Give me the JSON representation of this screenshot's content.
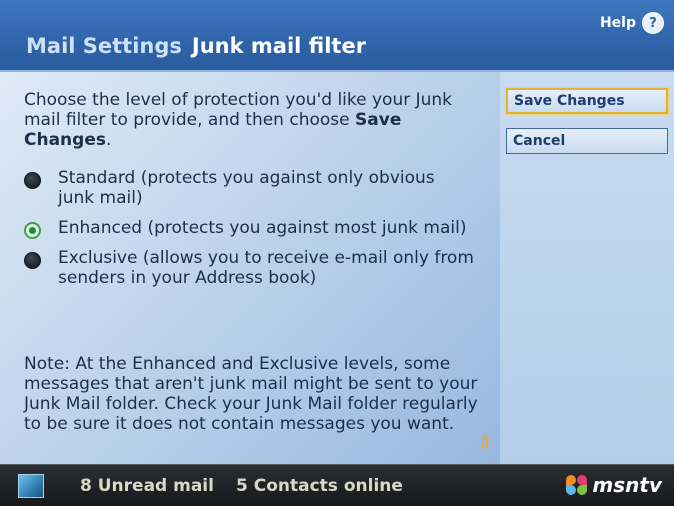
{
  "header": {
    "section": "Mail Settings",
    "title": "Junk mail filter",
    "help_label": "Help",
    "help_icon": "question-circle-icon"
  },
  "intro": {
    "text_before": "Choose the level of protection you'd like your Junk mail filter to provide, and then choose ",
    "bold": "Save Changes",
    "text_after": "."
  },
  "options": [
    {
      "label": "Standard (protects you against only obvious junk mail)",
      "selected": false
    },
    {
      "label": "Enhanced (protects you against most junk mail)",
      "selected": true
    },
    {
      "label": "Exclusive (allows you to receive e-mail only from senders in your Address book)",
      "selected": false
    }
  ],
  "note": "Note: At the Enhanced and Exclusive levels, some messages that aren't junk mail might be sent to your Junk Mail folder. Check your Junk Mail folder regularly to be sure it does not contain messages you want.",
  "buttons": {
    "save": "Save Changes",
    "cancel": "Cancel"
  },
  "statusbar": {
    "unread": "8 Unread mail",
    "contacts": "5 Contacts online",
    "brand": "msntv"
  },
  "colors": {
    "header_blue": "#2f64aa",
    "focus_yellow": "#e0b430",
    "selected_green": "#3aa14b",
    "scroll_arrow": "#f2a61c"
  }
}
